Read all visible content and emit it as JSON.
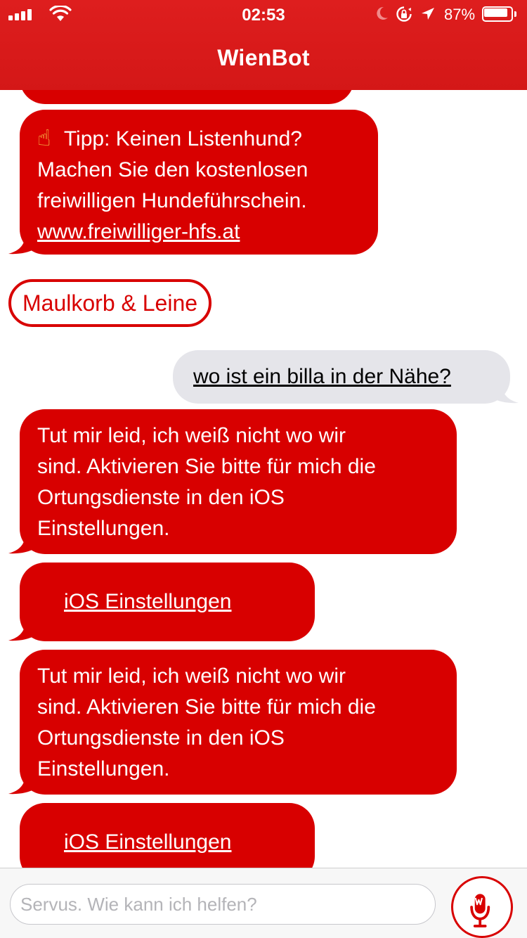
{
  "status_bar": {
    "time": "02:53",
    "battery_percent": "87%",
    "battery_level": 0.87
  },
  "nav": {
    "title": "WienBot"
  },
  "colors": {
    "brand_red": "#d80000",
    "header_red": "#de1e1e",
    "user_bubble": "#e5e5ea"
  },
  "messages": {
    "tip": {
      "emoji": "☝",
      "line1": "Tipp: Keinen Listenhund?",
      "line2": "Machen Sie den kostenlosen",
      "line3": "freiwilligen Hundeführschein.",
      "link": "www.freiwilliger-hfs.at"
    },
    "quick_reply": "Maulkorb & Leine",
    "user_question": "wo ist ein billa in der Nähe?",
    "bot_reply_1": {
      "line1": "Tut mir leid, ich weiß nicht wo wir",
      "line2": "sind. Aktivieren Sie bitte für mich die",
      "line3": "Ortungsdienste in den iOS",
      "line4": "Einstellungen."
    },
    "settings_button_1": "iOS Einstellungen",
    "bot_reply_2": {
      "line1": "Tut mir leid, ich weiß nicht wo wir",
      "line2": "sind. Aktivieren Sie bitte für mich die",
      "line3": "Ortungsdienste in den iOS",
      "line4": "Einstellungen."
    },
    "settings_button_2": "iOS Einstellungen"
  },
  "input": {
    "placeholder": "Servus. Wie kann ich helfen?",
    "value": ""
  },
  "icons": {
    "signal": "signal-bars-icon",
    "wifi": "wifi-icon",
    "moon": "do-not-disturb-moon-icon",
    "rotation_lock": "rotation-lock-icon",
    "location": "location-arrow-icon",
    "battery": "battery-icon",
    "microphone": "wienbot-microphone-icon"
  }
}
